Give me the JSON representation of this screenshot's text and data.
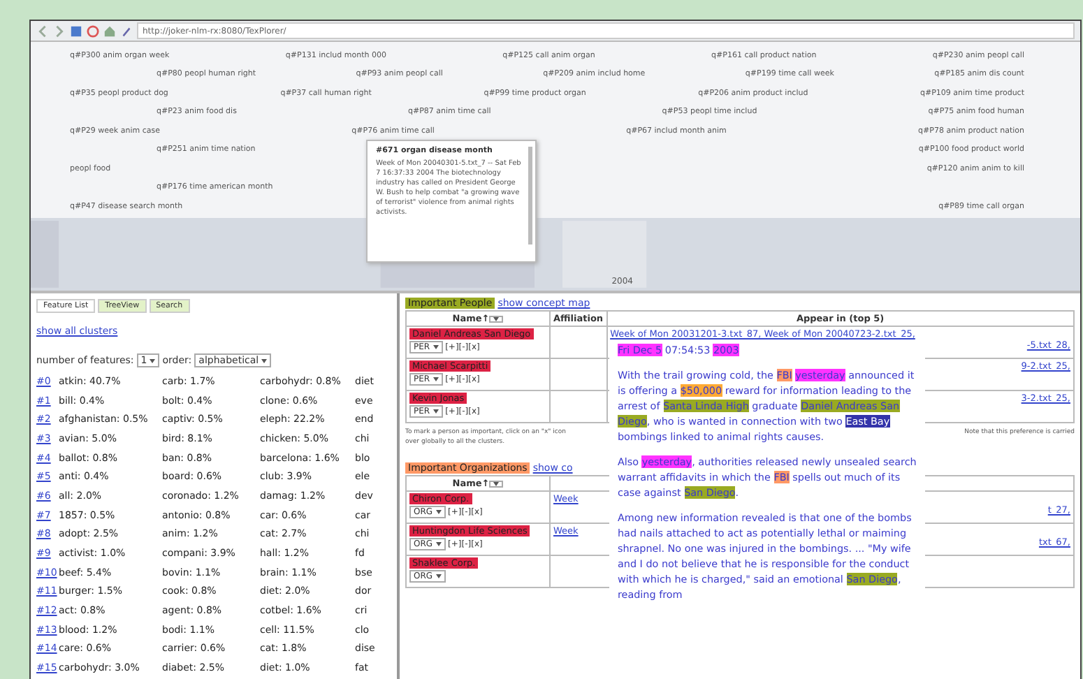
{
  "browser": {
    "url": "http://joker-nlm-rx:8080/TexPlorer/"
  },
  "cluster_map": {
    "rows": [
      [
        "q#P300 anim organ week",
        "q#P131 includ month 000",
        "q#P125 call anim organ",
        "q#P161 call product nation",
        "q#P230 anim peopl call"
      ],
      [
        "q#P80 peopl human right",
        "q#P93 anim peopl call",
        "q#P209 anim includ home",
        "q#P199 time call week",
        "q#P185 anim dis count"
      ],
      [
        "q#P35 peopl product dog",
        "q#P37 call human right",
        "q#P99 time product organ",
        "q#P206 anim product includ",
        "q#P109 anim time product"
      ],
      [
        "q#P23 anim food dis",
        "q#P87 anim time call",
        "q#P53 peopl time includ",
        "q#P75 anim food human"
      ],
      [
        "q#P29 week anim case",
        "q#P76 anim time call",
        "q#P67 includ month anim",
        "q#P78 anim product nation"
      ],
      [
        "q#P251 anim time nation",
        "q#P100 food product world"
      ],
      [
        "peopl food",
        "q#P120 anim anim to kill"
      ],
      [
        "q#P176 time american month"
      ],
      [
        "q#P47 disease search month",
        "q#P89 time call organ"
      ]
    ],
    "timeline_label": "2004",
    "tooltip": {
      "title": "#671 organ disease month",
      "text": "Week of Mon 20040301-5.txt_7 -- Sat Feb 7 16:37:33 2004 The biotechnology industry has called on President George W. Bush to help combat \"a growing wave of terrorist\" violence from animal rights activists."
    }
  },
  "left_panel": {
    "tabs": [
      {
        "label": "Feature List",
        "selected": true
      },
      {
        "label": "TreeView",
        "selected": false
      },
      {
        "label": "Search",
        "selected": false
      }
    ],
    "link": "show all clusters",
    "features_label": "number of features:",
    "features_value": "1",
    "order_label": "order:",
    "order_value": "alphabetical",
    "clusters": [
      {
        "id": "#0",
        "cells": [
          "atkin: 40.7%",
          "carb: 1.7%",
          "carbohydr: 0.8%",
          "diet"
        ]
      },
      {
        "id": "#1",
        "cells": [
          "bill: 0.4%",
          "bolt: 0.4%",
          "clone: 0.6%",
          "eve"
        ]
      },
      {
        "id": "#2",
        "cells": [
          "afghanistan: 0.5%",
          "captiv: 0.5%",
          "eleph: 22.2%",
          "end"
        ]
      },
      {
        "id": "#3",
        "cells": [
          "avian: 5.0%",
          "bird: 8.1%",
          "chicken: 5.0%",
          "chi"
        ]
      },
      {
        "id": "#4",
        "cells": [
          "ballot: 0.8%",
          "ban: 0.8%",
          "barcelona: 1.6%",
          "blo"
        ]
      },
      {
        "id": "#5",
        "cells": [
          "anti: 0.4%",
          "board: 0.6%",
          "club: 3.9%",
          "ele"
        ]
      },
      {
        "id": "#6",
        "cells": [
          "all: 2.0%",
          "coronado: 1.2%",
          "damag: 1.2%",
          "dev"
        ]
      },
      {
        "id": "#7",
        "cells": [
          "1857: 0.5%",
          "antonio: 0.8%",
          "car: 0.6%",
          "car"
        ]
      },
      {
        "id": "#8",
        "cells": [
          "adopt: 2.5%",
          "anim: 1.2%",
          "cat: 2.7%",
          "chi"
        ]
      },
      {
        "id": "#9",
        "cells": [
          "activist: 1.0%",
          "compani: 3.9%",
          "hall: 1.2%",
          "fd"
        ]
      },
      {
        "id": "#10",
        "cells": [
          "beef: 5.4%",
          "bovin: 1.1%",
          "brain: 1.1%",
          "bse"
        ]
      },
      {
        "id": "#11",
        "cells": [
          "burger: 1.5%",
          "cook: 0.8%",
          "diet: 2.0%",
          "dor"
        ]
      },
      {
        "id": "#12",
        "cells": [
          "act: 0.8%",
          "agent: 0.8%",
          "cotbel: 1.6%",
          "cri"
        ]
      },
      {
        "id": "#13",
        "cells": [
          "blood: 1.2%",
          "bodi: 1.1%",
          "cell: 11.5%",
          "clo"
        ]
      },
      {
        "id": "#14",
        "cells": [
          "care: 0.6%",
          "carrier: 0.6%",
          "cat: 1.8%",
          "dise"
        ]
      },
      {
        "id": "#15",
        "cells": [
          "carbohydr: 3.0%",
          "diabet: 2.5%",
          "diet: 1.0%",
          "fat"
        ]
      }
    ]
  },
  "right_panel": {
    "people": {
      "tag": "Important People",
      "link": "show concept map",
      "columns": [
        "Name↑",
        "Affiliation",
        "Appear in (top 5)"
      ],
      "rows": [
        {
          "name": "Daniel Andreas San Diego",
          "type": "PER",
          "actions": "[+][-][x]",
          "appear": "Week of Mon 20031201-3.txt_87, Week of Mon 20040723-2.txt_25,",
          "appear_2": "-5.txt_28,"
        },
        {
          "name": "Michael Scarpitti",
          "type": "PER",
          "actions": "[+][-][x]",
          "appear_2": "9-2.txt_25,"
        },
        {
          "name": "Kevin Jonas",
          "type": "PER",
          "actions": "[+][-][x]",
          "appear_2": "3-2.txt_25,"
        }
      ],
      "note": "To mark a person as important, click on an \"x\" icon",
      "note_2": "Note that this preference is carried",
      "note_3": "over globally to all the clusters."
    },
    "organizations": {
      "tag": "Important Organizations",
      "link": "show co",
      "column": "Name↑",
      "rows": [
        {
          "name": "Chiron Corp.",
          "type": "ORG",
          "actions": "[+][-][x]",
          "appear": "Week",
          "appear_end": "t_27,"
        },
        {
          "name": "Huntingdon Life Sciences",
          "type": "ORG",
          "actions": "[+][-][x]",
          "appear": "Week",
          "appear_end": "txt_67,"
        },
        {
          "name": "Shaklee Corp.",
          "type": "ORG"
        }
      ]
    },
    "popup": {
      "paragraphs": [
        [
          {
            "text": "Fri Dec 5",
            "color": "#ff33ff"
          },
          {
            "text": " 07:54:53 "
          },
          {
            "text": "2003",
            "color": "#ff33ff"
          }
        ],
        [
          {
            "text": "With the trail growing cold, the "
          },
          {
            "text": "FBI",
            "color": "#ff9966"
          },
          {
            "text": "yesterday",
            "color": "#ff33ff"
          },
          {
            "text": " announced it is offering a "
          },
          {
            "text": "$50,000",
            "color": "#ffaa33"
          },
          {
            "text": " reward for information leading to the arrest of "
          },
          {
            "text": "Santa Linda High",
            "color": "#99aa22"
          },
          {
            "text": " graduate "
          },
          {
            "text": "Daniel Andreas San Diego",
            "color": "#99aa22"
          },
          {
            "text": ", who is wanted in connection with two "
          },
          {
            "text": "East Bay",
            "color": "#3333aa"
          },
          {
            "text": " bombings linked to animal rights causes."
          }
        ],
        [
          {
            "text": "Also "
          },
          {
            "text": "yesterday",
            "color": "#ff33ff"
          },
          {
            "text": ", authorities released newly unsealed search warrant affidavits in which the "
          },
          {
            "text": "FBI",
            "color": "#ff9966"
          },
          {
            "text": " spells out much of its case against "
          },
          {
            "text": "San Diego",
            "color": "#99aa22"
          },
          {
            "text": "."
          }
        ],
        [
          {
            "text": "Among new information revealed is that one of the bombs had nails attached to act as potentially lethal or maiming shrapnel. No one was injured in the bombings. ... \"My wife and I do not believe that he is responsible for the conduct with which he is charged,\" said an emotional "
          },
          {
            "text": "San Diego",
            "color": "#99aa22"
          },
          {
            "text": ", reading from"
          }
        ]
      ]
    }
  }
}
